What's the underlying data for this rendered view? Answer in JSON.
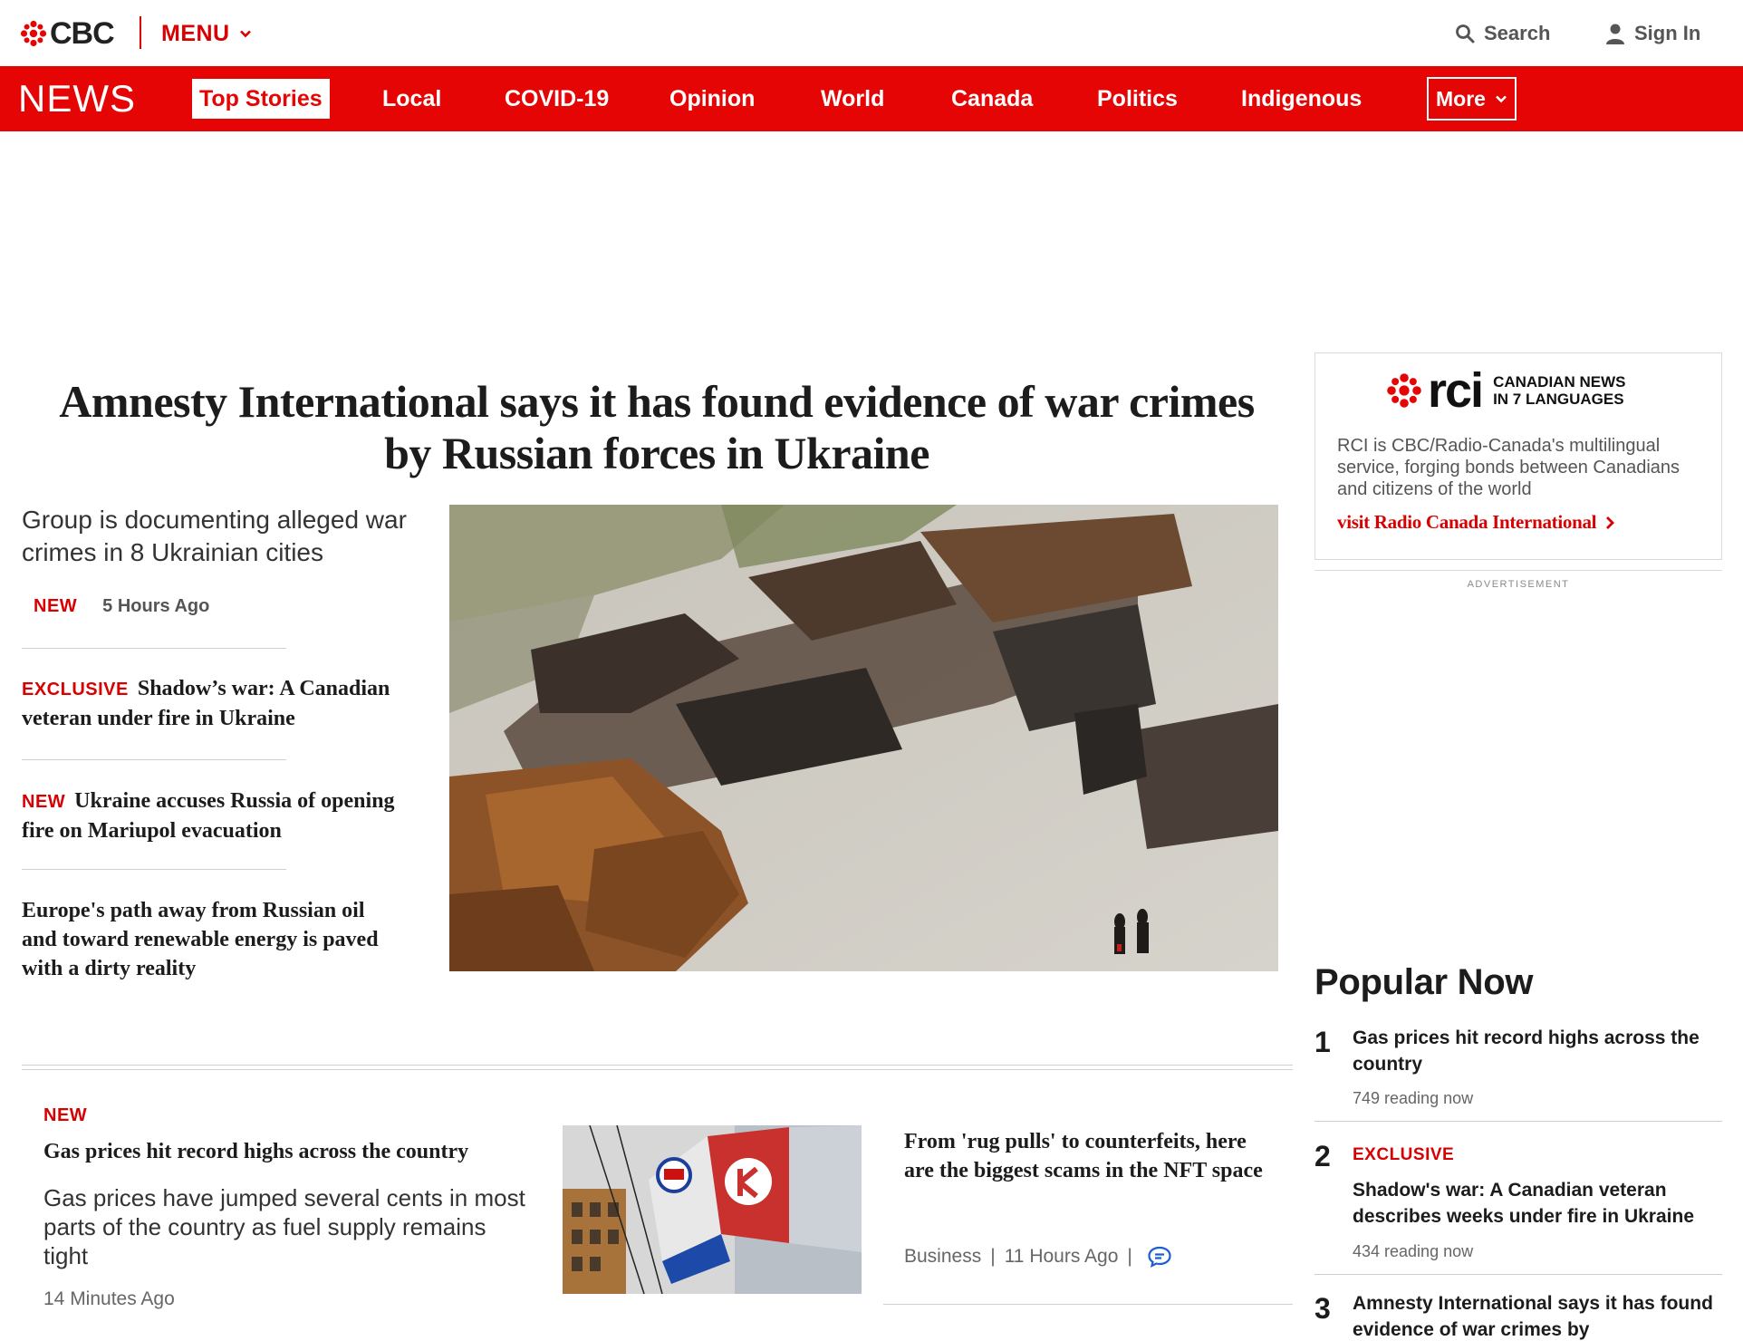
{
  "header": {
    "logo_text": "CBC",
    "menu_label": "MENU",
    "search_label": "Search",
    "signin_label": "Sign In"
  },
  "nav": {
    "section_title": "NEWS",
    "items": [
      "Top Stories",
      "Local",
      "COVID-19",
      "Opinion",
      "World",
      "Canada",
      "Politics",
      "Indigenous"
    ],
    "active_item": "Top Stories",
    "more_label": "More"
  },
  "lead": {
    "headline": "Amnesty International says it has found evidence of war crimes by Russian forces in Ukraine",
    "deck": "Group is documenting alleged war crimes in 8 Ukrainian cities",
    "badge": "NEW",
    "time": "5 Hours Ago",
    "image_alt": "Destroyed Russian military vehicles in Ukraine"
  },
  "side_stories": [
    {
      "tag": "EXCLUSIVE",
      "title": "Shadow’s war: A Canadian veteran under fire in Ukraine"
    },
    {
      "tag": "NEW",
      "title": "Ukraine accuses Russia of opening fire on Mariupol evacuation"
    },
    {
      "tag": "",
      "title": "Europe's path away from Russian oil and toward renewable energy is paved with a dirty reality"
    }
  ],
  "cards": {
    "gas": {
      "tag": "NEW",
      "title": "Gas prices hit record highs across the country",
      "summary": "Gas prices have jumped several cents in most parts of the country as fuel supply remains tight",
      "time": "14 Minutes Ago"
    },
    "nft": {
      "title": "From 'rug pulls' to counterfeits, here are the biggest scams in the NFT space",
      "category": "Business",
      "time": "11 Hours Ago",
      "separator": "|"
    }
  },
  "rci": {
    "logo_word": "rci",
    "tagline_line1": "CANADIAN NEWS",
    "tagline_line2": "IN 7 LANGUAGES",
    "description": "RCI is CBC/Radio-Canada's multilingual service, forging bonds between Canadians and citizens of the world",
    "link": "visit Radio Canada International"
  },
  "advertisement_label": "ADVERTISEMENT",
  "popular": {
    "title": "Popular Now",
    "items": [
      {
        "rank": "1",
        "tag": "",
        "title": "Gas prices hit record highs across the country",
        "reading": "749 reading now"
      },
      {
        "rank": "2",
        "tag": "EXCLUSIVE",
        "title": "Shadow's war: A Canadian veteran describes weeks under fire in Ukraine",
        "reading": "434 reading now"
      },
      {
        "rank": "3",
        "tag": "",
        "title": "Amnesty International says it has found evidence of war crimes by",
        "reading": ""
      }
    ]
  },
  "colors": {
    "brand_red": "#e60505",
    "tag_red": "#d80000",
    "icon_blue": "#1a5fd0"
  }
}
